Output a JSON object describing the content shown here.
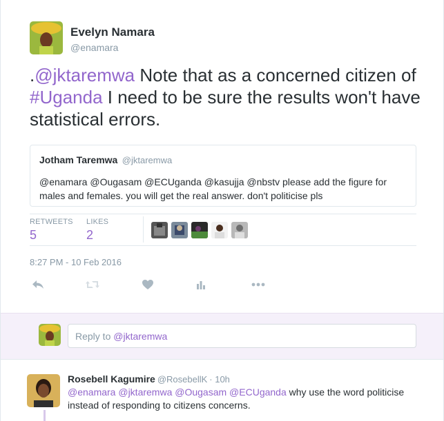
{
  "tweet": {
    "author_name": "Evelyn Namara",
    "author_handle": "@enamara",
    "text_prefix": ".",
    "text_mention": "@jktaremwa",
    "text_middle": " Note that as a concerned citizen of ",
    "text_hashtag": "#Uganda",
    "text_suffix": " I need to be sure the results won't have statistical errors.",
    "timestamp": "8:27 PM - 10 Feb 2016"
  },
  "quote": {
    "name": "Jotham Taremwa",
    "handle": "@jktaremwa",
    "text": "@enamara @Ougasam @ECUganda @kasujja @nbstv please add the figure for males and females. you will get the real answer. don't politicise pls"
  },
  "stats": {
    "retweets_label": "RETWEETS",
    "retweets_value": "5",
    "likes_label": "LIKES",
    "likes_value": "2"
  },
  "actions": [
    "reply-icon",
    "retweet-icon",
    "heart-icon",
    "analytics-icon",
    "more-icon"
  ],
  "reply_box": {
    "prefix": "Reply to ",
    "mention": "@jktaremwa"
  },
  "reply": {
    "name": "Rosebell Kagumire",
    "handle": "@RosebellK",
    "time": "· 10h",
    "mentions": "@enamara @jktaremwa @Ougasam @ECUganda",
    "text": " why use the word politicise instead of responding to citizens concerns."
  },
  "colors": {
    "accent": "#9266cc",
    "muted": "#8899a6",
    "reply_bg": "#f5f0fa"
  }
}
